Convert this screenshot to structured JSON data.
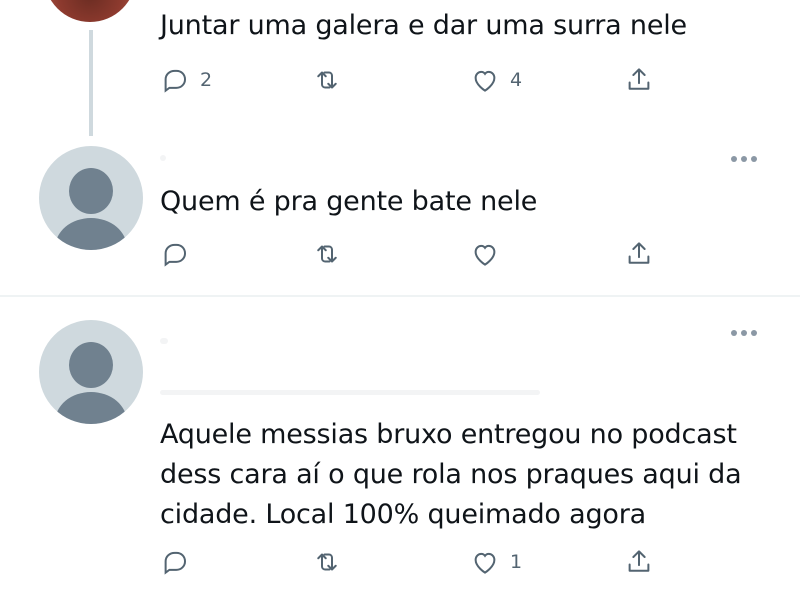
{
  "tweets": [
    {
      "text": "Juntar uma galera e dar uma surra nele",
      "replies": "2",
      "retweets": "",
      "likes": "4"
    },
    {
      "text": "Quem é pra gente bate nele",
      "replies": "",
      "retweets": "",
      "likes": ""
    },
    {
      "text_lines": [
        "Aquele messias bruxo entregou no podcast",
        "dess cara aí o que rola nos praques aqui da",
        "cidade. Local 100% queimado agora"
      ],
      "replies": "",
      "retweets": "",
      "likes": "1"
    }
  ],
  "icons": {
    "reply": "reply-icon",
    "retweet": "retweet-icon",
    "like": "heart-icon",
    "share": "share-icon",
    "more": "more-options-icon"
  },
  "colors": {
    "text": "#0f1419",
    "icon": "#536471",
    "avatar_placeholder": "#cfd9de",
    "thread_line": "#cfd9de"
  }
}
